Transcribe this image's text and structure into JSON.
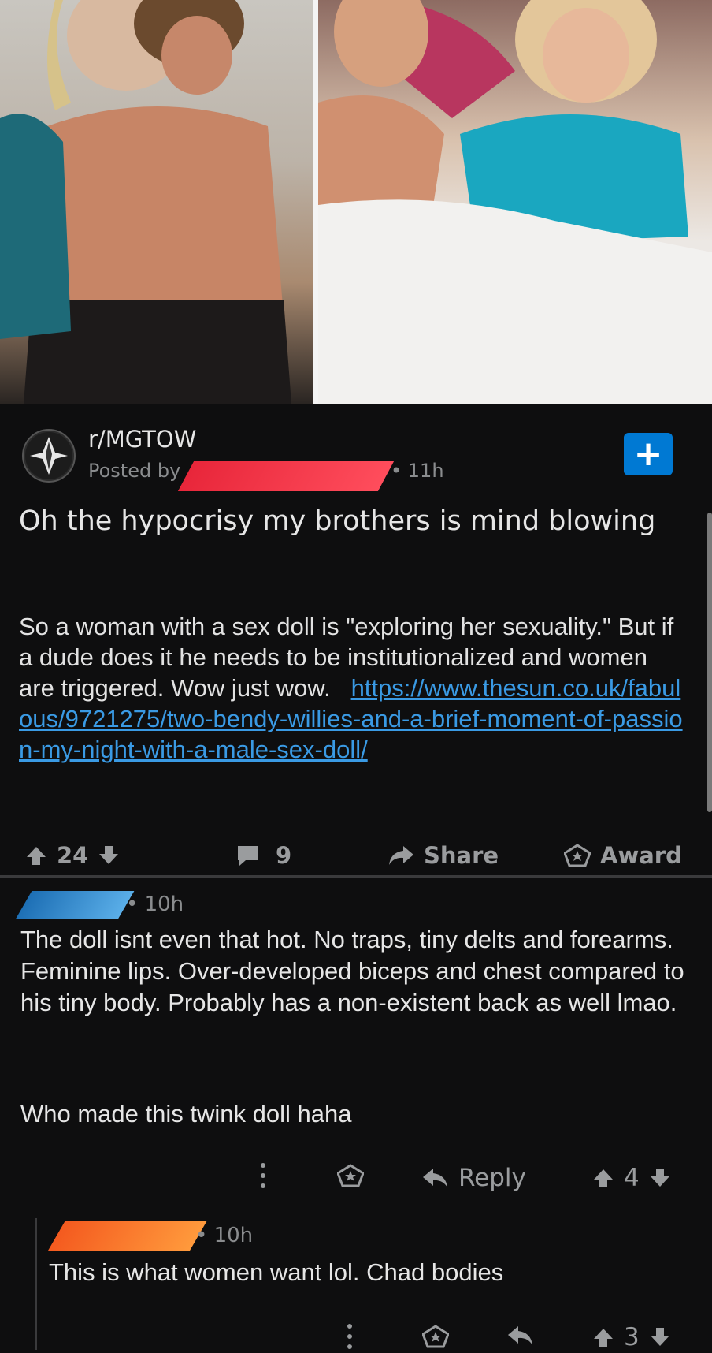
{
  "post": {
    "subreddit": "r/MGTOW",
    "posted_by_prefix": "Posted by",
    "time": "• 11h",
    "title": "Oh the hypocrisy my brothers is mind blowing",
    "body_text": "So a woman with a sex doll is \"exploring her sexuality.\" But if a dude does it he needs to be institutionalized and women are triggered. Wow just wow.",
    "link": "https://www.thesun.co.uk/fabulous/9721275/two-bendy-willies-and-a-brief-moment-of-passion-my-night-with-a-male-sex-doll/",
    "votes": "24",
    "comments": "9",
    "share_label": "Share",
    "award_label": "Award"
  },
  "comment1": {
    "time": "• 10h",
    "text": "The doll isnt even that hot. No traps, tiny delts and forearms. Feminine lips. Over-developed biceps and chest compared to his tiny body. Probably has a non-existent back as well lmao.",
    "text2": "Who made this twink doll haha",
    "reply_label": "Reply",
    "votes": "4"
  },
  "comment2": {
    "time": "• 10h",
    "text": "This is what women want lol. Chad bodies",
    "votes": "3"
  },
  "colors": {
    "background": "#0e0e0f",
    "link": "#3a9ae4",
    "join_button": "#0079d3"
  }
}
